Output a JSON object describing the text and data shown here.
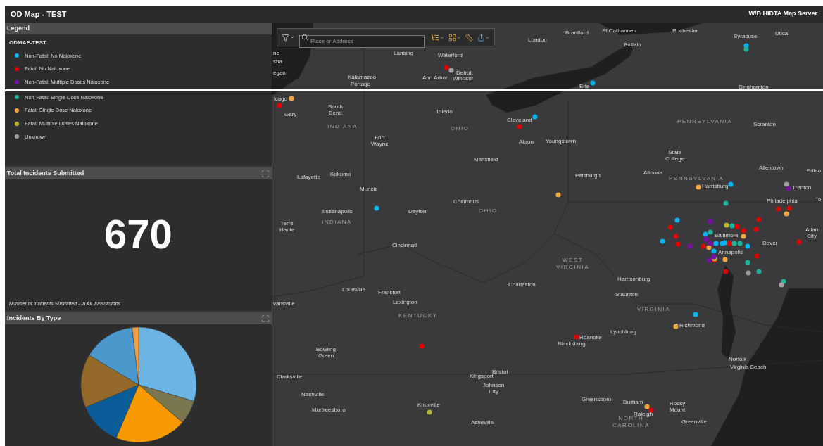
{
  "header": {
    "title": "OD Map - TEST",
    "server": "W/B HIDTA Map Server"
  },
  "legend": {
    "title": "Legend",
    "layer": "ODMAP-TEST",
    "items": [
      {
        "label": "Non-Fatal: No Naloxone",
        "color": "#00b4f0"
      },
      {
        "label": "Fatal: No Naloxone",
        "color": "#e60000"
      },
      {
        "label": "Non-Fatal: Multiple Doses Naloxone",
        "color": "#7a0fa8"
      },
      {
        "label": "Non-Fatal: Single Dose Naloxone",
        "color": "#1fb39a"
      },
      {
        "label": "Fatal: Single Dose Naloxone",
        "color": "#f5a442"
      },
      {
        "label": "Fatal: Multiple Doses Naloxone",
        "color": "#b8b830"
      },
      {
        "label": "Unknown",
        "color": "#a0a0a0"
      }
    ]
  },
  "toolbar": {
    "search": {
      "placeholder": "Place or Address"
    }
  },
  "total_panel": {
    "title": "Total Incidents Submitted",
    "value": "670",
    "caption": "Number of Incidents Submitted - In All Jurisdictions"
  },
  "type_panel": {
    "title": "Incidents By Type"
  },
  "map": {
    "labels": [
      {
        "text": "ne",
        "kind": "city"
      },
      {
        "text": "sha",
        "kind": "city"
      },
      {
        "text": "egan",
        "kind": "city"
      },
      {
        "text": "Lansing",
        "kind": "city"
      },
      {
        "text": "Waterford",
        "kind": "city"
      },
      {
        "text": "London",
        "kind": "city"
      },
      {
        "text": "Brantford",
        "kind": "city"
      },
      {
        "text": "St Cathannes",
        "kind": "city"
      },
      {
        "text": "Rochester",
        "kind": "city"
      },
      {
        "text": "Buffalo",
        "kind": "city"
      },
      {
        "text": "Syracuse",
        "kind": "city"
      },
      {
        "text": "Utica",
        "kind": "city"
      },
      {
        "text": "Kalamazoo",
        "kind": "city"
      },
      {
        "text": "Portage",
        "kind": "city"
      },
      {
        "text": "Ann Arbor",
        "kind": "city"
      },
      {
        "text": "Detroit",
        "kind": "city"
      },
      {
        "text": "Windsor",
        "kind": "city"
      },
      {
        "text": "Erie",
        "kind": "city"
      },
      {
        "text": "Binghamton",
        "kind": "city"
      },
      {
        "text": "icago",
        "kind": "city"
      },
      {
        "text": "Gary",
        "kind": "city"
      },
      {
        "text": "South Bend",
        "kind": "city"
      },
      {
        "text": "Toledo",
        "kind": "city"
      },
      {
        "text": "Cleveland",
        "kind": "city"
      },
      {
        "text": "Fort Wayne",
        "kind": "city"
      },
      {
        "text": "Akron",
        "kind": "city"
      },
      {
        "text": "Youngstown",
        "kind": "city"
      },
      {
        "text": "Mansfield",
        "kind": "city"
      },
      {
        "text": "Pittsburgh",
        "kind": "city"
      },
      {
        "text": "Altoona",
        "kind": "city"
      },
      {
        "text": "State College",
        "kind": "city"
      },
      {
        "text": "Scranton",
        "kind": "city"
      },
      {
        "text": "Allentown",
        "kind": "city"
      },
      {
        "text": "Ediso",
        "kind": "city"
      },
      {
        "text": "Harrisburg",
        "kind": "city"
      },
      {
        "text": "Trenton",
        "kind": "city"
      },
      {
        "text": "Philadelphia",
        "kind": "city"
      },
      {
        "text": "To",
        "kind": "city"
      },
      {
        "text": "Lafayette",
        "kind": "city"
      },
      {
        "text": "Kokomo",
        "kind": "city"
      },
      {
        "text": "Muncie",
        "kind": "city"
      },
      {
        "text": "Indianapolis",
        "kind": "city"
      },
      {
        "text": "Dayton",
        "kind": "city"
      },
      {
        "text": "Columbus",
        "kind": "city"
      },
      {
        "text": "Terre Haute",
        "kind": "city"
      },
      {
        "text": "Cincinnati",
        "kind": "city"
      },
      {
        "text": "Baltimore",
        "kind": "city"
      },
      {
        "text": "Annapolis",
        "kind": "city"
      },
      {
        "text": "Dover",
        "kind": "city"
      },
      {
        "text": "Atlan City",
        "kind": "city"
      },
      {
        "text": "Louisville",
        "kind": "city"
      },
      {
        "text": "Frankfort",
        "kind": "city"
      },
      {
        "text": "Lexington",
        "kind": "city"
      },
      {
        "text": "Charleston",
        "kind": "city"
      },
      {
        "text": "vansville",
        "kind": "city"
      },
      {
        "text": "Harrisonburg",
        "kind": "city"
      },
      {
        "text": "Staunton",
        "kind": "city"
      },
      {
        "text": "Richmond",
        "kind": "city"
      },
      {
        "text": "Lynchburg",
        "kind": "city"
      },
      {
        "text": "Roanoke",
        "kind": "city"
      },
      {
        "text": "Blacksburg",
        "kind": "city"
      },
      {
        "text": "Bowling Green",
        "kind": "city"
      },
      {
        "text": "Norfolk",
        "kind": "city"
      },
      {
        "text": "Virginia Beach",
        "kind": "city"
      },
      {
        "text": "Clarksville",
        "kind": "city"
      },
      {
        "text": "Kingsport",
        "kind": "city"
      },
      {
        "text": "Bristol",
        "kind": "city"
      },
      {
        "text": "Johnson City",
        "kind": "city"
      },
      {
        "text": "Nashville",
        "kind": "city"
      },
      {
        "text": "Murfreesboro",
        "kind": "city"
      },
      {
        "text": "Knoxville",
        "kind": "city"
      },
      {
        "text": "Greensboro",
        "kind": "city"
      },
      {
        "text": "Durham",
        "kind": "city"
      },
      {
        "text": "Rocky Mount",
        "kind": "city"
      },
      {
        "text": "Raleigh",
        "kind": "city"
      },
      {
        "text": "Asheville",
        "kind": "city"
      },
      {
        "text": "Greenville",
        "kind": "city"
      },
      {
        "text": "INDIANA",
        "kind": "state"
      },
      {
        "text": "OHIO",
        "kind": "state"
      },
      {
        "text": "INDIANA",
        "kind": "state"
      },
      {
        "text": "OHIO",
        "kind": "state"
      },
      {
        "text": "PENNSYLVANIA",
        "kind": "state"
      },
      {
        "text": "PENNSYLVANIA",
        "kind": "state"
      },
      {
        "text": "WEST VIRGINIA",
        "kind": "state"
      },
      {
        "text": "VIRGINIA",
        "kind": "state"
      },
      {
        "text": "KENTUCKY",
        "kind": "state"
      },
      {
        "text": "NORTH CAROLINA",
        "kind": "state"
      }
    ]
  }
}
